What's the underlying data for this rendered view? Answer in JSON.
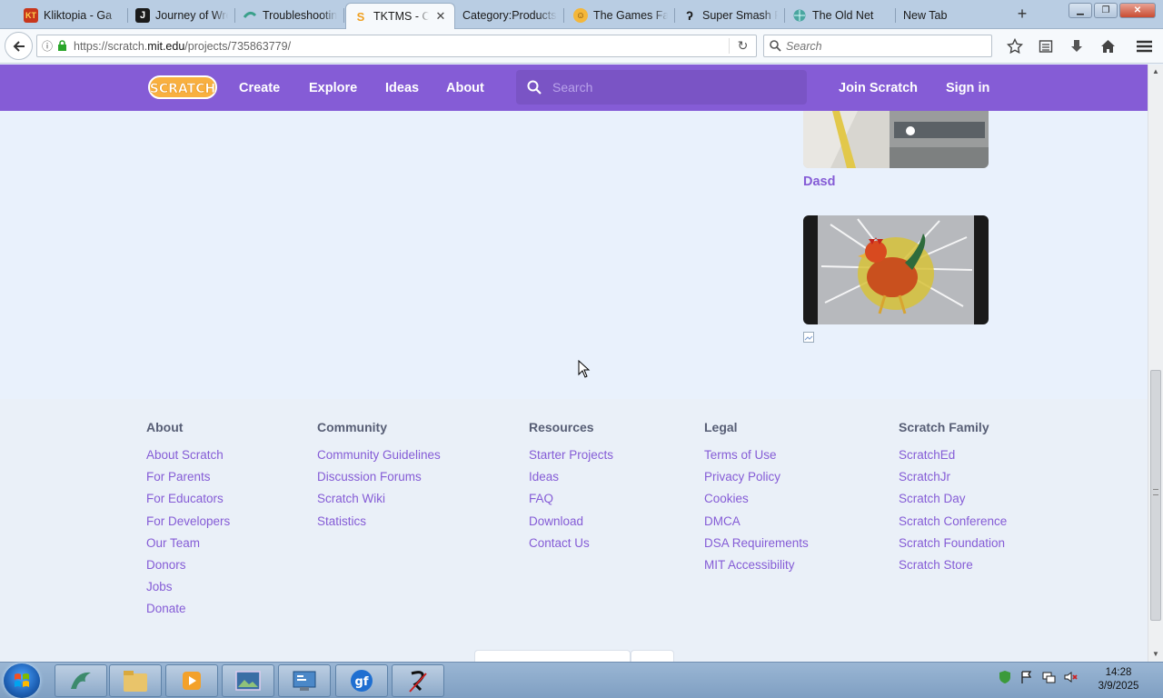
{
  "browser": {
    "tabs": [
      {
        "label": "Kliktopia - Ga",
        "icon": "kliktopia-icon",
        "active": false
      },
      {
        "label": "Journey of Wre",
        "icon": "journey-icon",
        "active": false
      },
      {
        "label": "Troubleshootin",
        "icon": "troubleshooting-icon",
        "active": false
      },
      {
        "label": "TKTMS - C",
        "icon": "scratch-tab-icon",
        "active": true
      },
      {
        "label": "Category:Products",
        "icon": "",
        "active": false
      },
      {
        "label": "The Games Fa",
        "icon": "games-factory-icon",
        "active": false
      },
      {
        "label": "Super Smash F",
        "icon": "smash-icon",
        "active": false
      },
      {
        "label": "The Old Net",
        "icon": "old-net-icon",
        "active": false
      },
      {
        "label": "New Tab",
        "icon": "",
        "active": false
      }
    ],
    "new_tab_label": "+",
    "url_prefix": "https://scratch.",
    "url_host": "mit.edu",
    "url_path": "/projects/735863779/",
    "search_placeholder": "Search"
  },
  "scratch": {
    "nav": {
      "create": "Create",
      "explore": "Explore",
      "ideas": "Ideas",
      "about": "About",
      "search_placeholder": "Search",
      "join": "Join Scratch",
      "signin": "Sign in"
    },
    "projects": [
      {
        "title": "Dasd"
      }
    ],
    "footer": {
      "about": {
        "heading": "About",
        "links": [
          "About Scratch",
          "For Parents",
          "For Educators",
          "For Developers",
          "Our Team",
          "Donors",
          "Jobs",
          "Donate"
        ]
      },
      "community": {
        "heading": "Community",
        "links": [
          "Community Guidelines",
          "Discussion Forums",
          "Scratch Wiki",
          "Statistics"
        ]
      },
      "resources": {
        "heading": "Resources",
        "links": [
          "Starter Projects",
          "Ideas",
          "FAQ",
          "Download",
          "Contact Us"
        ]
      },
      "legal": {
        "heading": "Legal",
        "links": [
          "Terms of Use",
          "Privacy Policy",
          "Cookies",
          "DMCA",
          "DSA Requirements",
          "MIT Accessibility"
        ]
      },
      "family": {
        "heading": "Scratch Family",
        "links": [
          "ScratchEd",
          "ScratchJr",
          "Scratch Day",
          "Scratch Conference",
          "Scratch Foundation",
          "Scratch Store"
        ]
      }
    },
    "colors": {
      "brand": "#855cd6",
      "footer_heading": "#575e75",
      "page_bg": "#e9f1fc"
    }
  },
  "taskbar": {
    "time": "14:28",
    "date": "3/9/2025"
  }
}
